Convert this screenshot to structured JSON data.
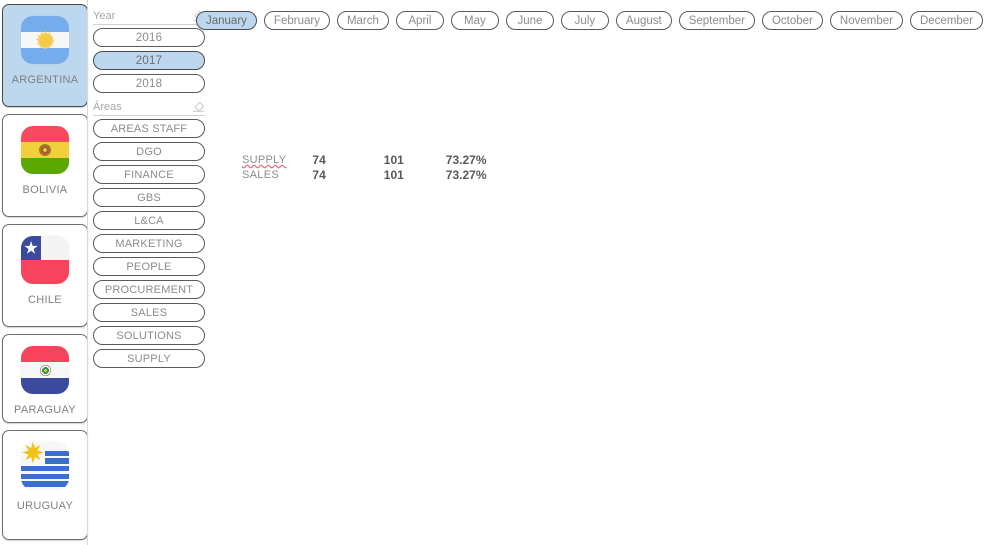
{
  "countries": [
    {
      "name": "ARGENTINA",
      "flag": "argentina-flag",
      "selected": true
    },
    {
      "name": "BOLIVIA",
      "flag": "bolivia-flag",
      "selected": false
    },
    {
      "name": "CHILE",
      "flag": "chile-flag",
      "selected": false
    },
    {
      "name": "PARAGUAY",
      "flag": "paraguay-flag",
      "selected": false
    },
    {
      "name": "URUGUAY",
      "flag": "uruguay-flag",
      "selected": false
    }
  ],
  "year_filter": {
    "title": "Year",
    "clear_icon": "eraser-icon",
    "options": [
      {
        "label": "2016",
        "selected": false
      },
      {
        "label": "2017",
        "selected": true
      },
      {
        "label": "2018",
        "selected": false
      }
    ]
  },
  "areas_filter": {
    "title": "Áreas",
    "clear_icon": "eraser-icon",
    "options": [
      {
        "label": "AREAS STAFF",
        "selected": false
      },
      {
        "label": "DGO",
        "selected": false
      },
      {
        "label": "FINANCE",
        "selected": false
      },
      {
        "label": "GBS",
        "selected": false
      },
      {
        "label": "L&CA",
        "selected": false
      },
      {
        "label": "MARKETING",
        "selected": false
      },
      {
        "label": "PEOPLE",
        "selected": false
      },
      {
        "label": "PROCUREMENT",
        "selected": false
      },
      {
        "label": "SALES",
        "selected": false
      },
      {
        "label": "SOLUTIONS",
        "selected": false
      },
      {
        "label": "SUPPLY",
        "selected": false
      }
    ]
  },
  "months": [
    {
      "label": "January",
      "selected": true
    },
    {
      "label": "February",
      "selected": false
    },
    {
      "label": "March",
      "selected": false
    },
    {
      "label": "April",
      "selected": false
    },
    {
      "label": "May",
      "selected": false
    },
    {
      "label": "June",
      "selected": false
    },
    {
      "label": "July",
      "selected": false
    },
    {
      "label": "August",
      "selected": false
    },
    {
      "label": "September",
      "selected": false
    },
    {
      "label": "October",
      "selected": false
    },
    {
      "label": "November",
      "selected": false
    },
    {
      "label": "December",
      "selected": false
    }
  ],
  "metrics": {
    "rows": [
      {
        "label": "SUPPLY",
        "misspelled": true,
        "col1": "74",
        "col2": "101",
        "col3": "73.27%"
      },
      {
        "label": "SALES",
        "misspelled": false,
        "col1": "74",
        "col2": "101",
        "col3": "73.27%"
      }
    ]
  },
  "colors": {
    "selection": "#bdd7ee",
    "pill_border": "#5a5a5a",
    "pill_text": "#8c8c8c",
    "value_text": "#595959",
    "background": "#ffffff"
  }
}
